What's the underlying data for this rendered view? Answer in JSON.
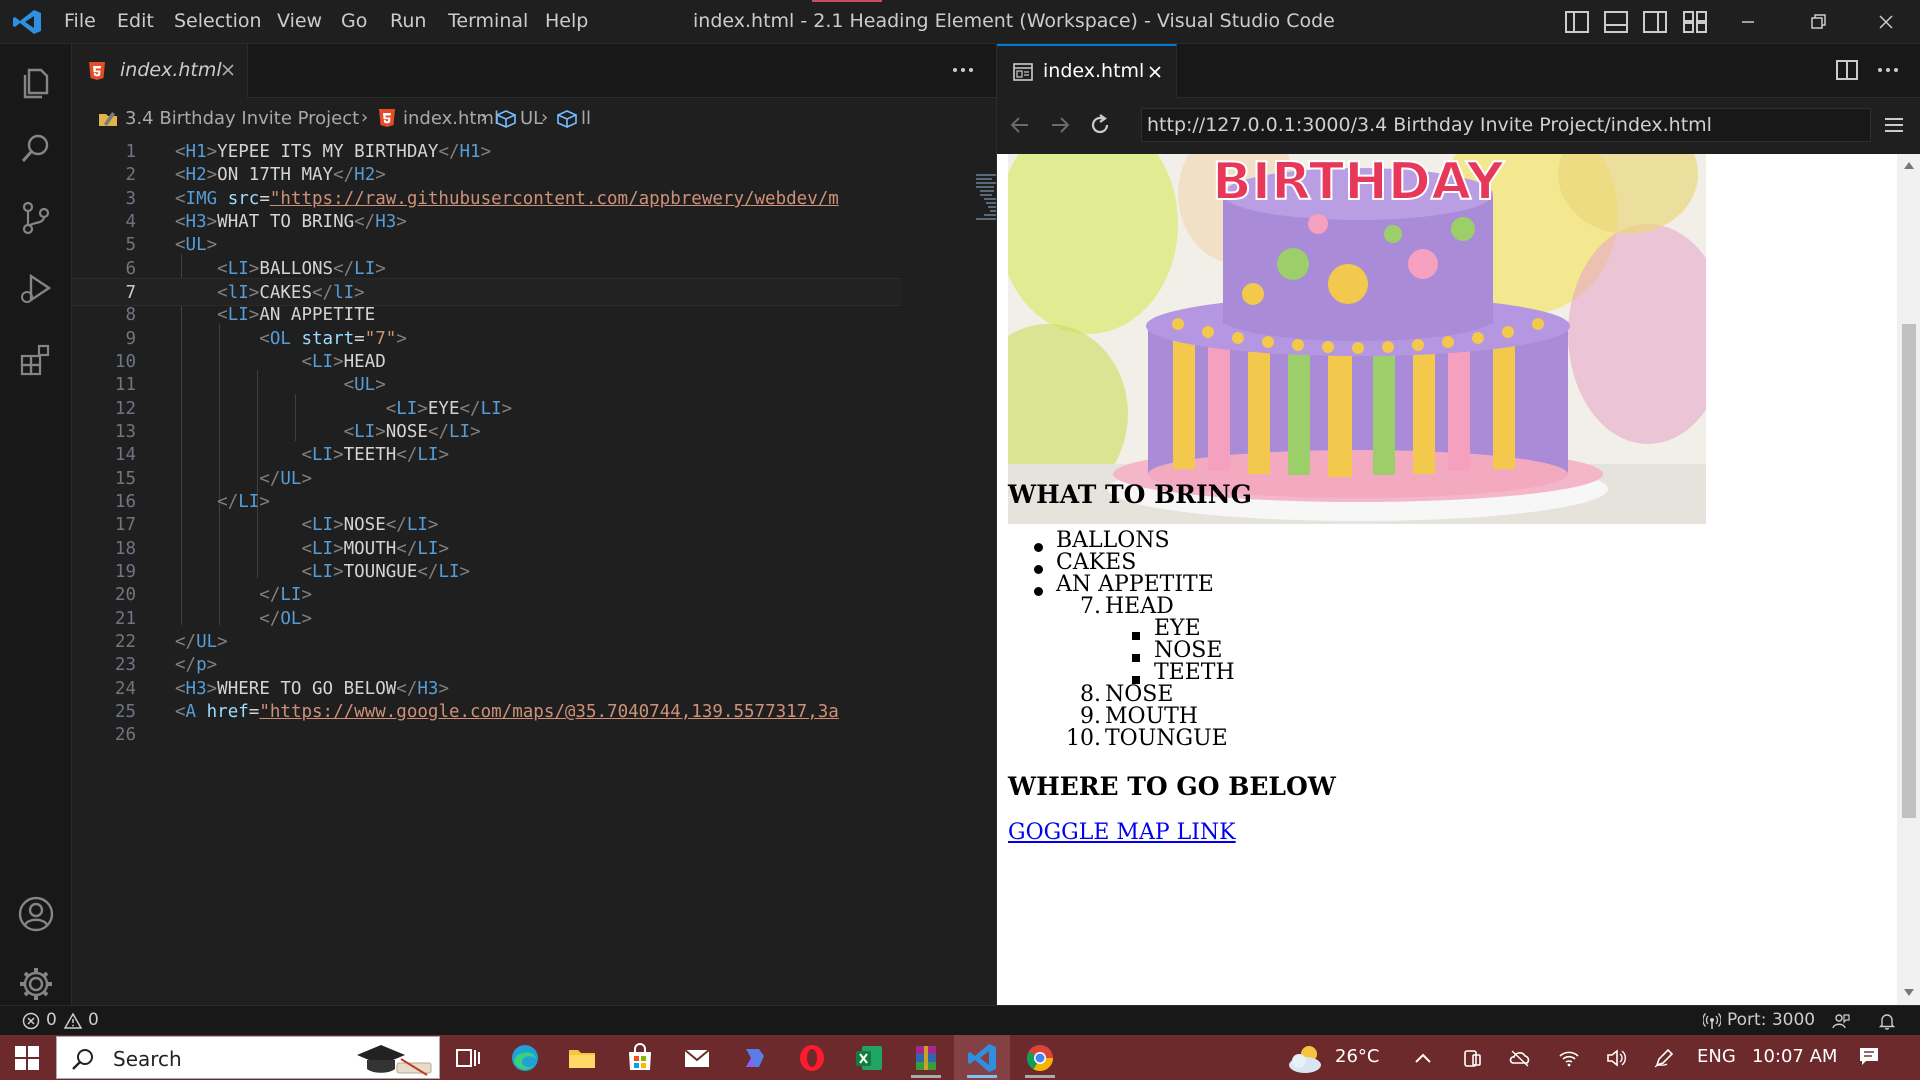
{
  "titlebar": {
    "menu": [
      "File",
      "Edit",
      "Selection",
      "View",
      "Go",
      "Run",
      "Terminal",
      "Help"
    ],
    "window_title": "index.html - 2.1 Heading Element (Workspace) - Visual Studio Code"
  },
  "editor": {
    "tab_label": "index.html",
    "breadcrumbs": [
      "3.4 Birthday Invite Project",
      "index.html",
      "UL",
      "ll"
    ],
    "current_line": 7,
    "lines": [
      {
        "n": "1"
      },
      {
        "n": "2"
      },
      {
        "n": "3"
      },
      {
        "n": "4"
      },
      {
        "n": "5"
      },
      {
        "n": "6"
      },
      {
        "n": "7"
      },
      {
        "n": "8"
      },
      {
        "n": "9"
      },
      {
        "n": "10"
      },
      {
        "n": "11"
      },
      {
        "n": "12"
      },
      {
        "n": "13"
      },
      {
        "n": "14"
      },
      {
        "n": "15"
      },
      {
        "n": "16"
      },
      {
        "n": "17"
      },
      {
        "n": "18"
      },
      {
        "n": "19"
      },
      {
        "n": "20"
      },
      {
        "n": "21"
      },
      {
        "n": "22"
      },
      {
        "n": "23"
      },
      {
        "n": "24"
      },
      {
        "n": "25"
      },
      {
        "n": "26"
      }
    ],
    "code": {
      "l1": "YEPEE ITS MY BIRTHDAY",
      "l2": "ON 17TH MAY",
      "l3_url": "\"https://raw.githubusercontent.com/appbrewery/webdev/m",
      "l4": "WHAT TO BRING",
      "l6": "BALLONS",
      "l7": "CAKES",
      "l8": "AN APPETITE",
      "l9_val": "\"7\"",
      "l10": "HEAD",
      "l12": "EYE",
      "l13": "NOSE",
      "l14": "TEETH",
      "l17": "NOSE",
      "l18": "MOUTH",
      "l19": "TOUNGUE",
      "l24": "WHERE TO GO BELOW",
      "l25_url": "\"https://www.google.com/maps/@35.7040744,139.5577317,3a"
    }
  },
  "preview": {
    "tab_label": "index.html",
    "url": "http://127.0.0.1:3000/3.4 Birthday Invite Project/index.html",
    "cake_text": "BIRTHDAY",
    "heading_bring": "WHAT TO BRING",
    "ul_items": [
      "BALLONS",
      "CAKES",
      "AN APPETITE"
    ],
    "ol_items": [
      {
        "num": "7.",
        "text": "HEAD"
      },
      {
        "num": "8.",
        "text": "NOSE"
      },
      {
        "num": "9.",
        "text": "MOUTH"
      },
      {
        "num": "10.",
        "text": "TOUNGUE"
      }
    ],
    "nested_items": [
      "EYE",
      "NOSE",
      "TEETH"
    ],
    "heading_where": "WHERE TO GO BELOW",
    "link_text": "GOGGLE MAP LINK"
  },
  "statusbar": {
    "errors": "0",
    "warnings": "0",
    "port": "Port: 3000"
  },
  "taskbar": {
    "search_placeholder": "Search",
    "weather": "26°C",
    "language": "ENG",
    "time": "10:07 AM",
    "apps": [
      "task-view-icon",
      "edge-icon",
      "file-explorer-icon",
      "store-icon",
      "mail-icon",
      "copilot-icon",
      "opera-icon",
      "excel-icon",
      "winrar-icon",
      "vscode-icon",
      "chrome-icon"
    ]
  },
  "colors": {
    "tag": "#569cd6",
    "attribute": "#9cdcfe",
    "string": "#ce9178",
    "accent": "#0078d4",
    "link": "#0000ee",
    "taskbar": "#6c2a2c"
  }
}
